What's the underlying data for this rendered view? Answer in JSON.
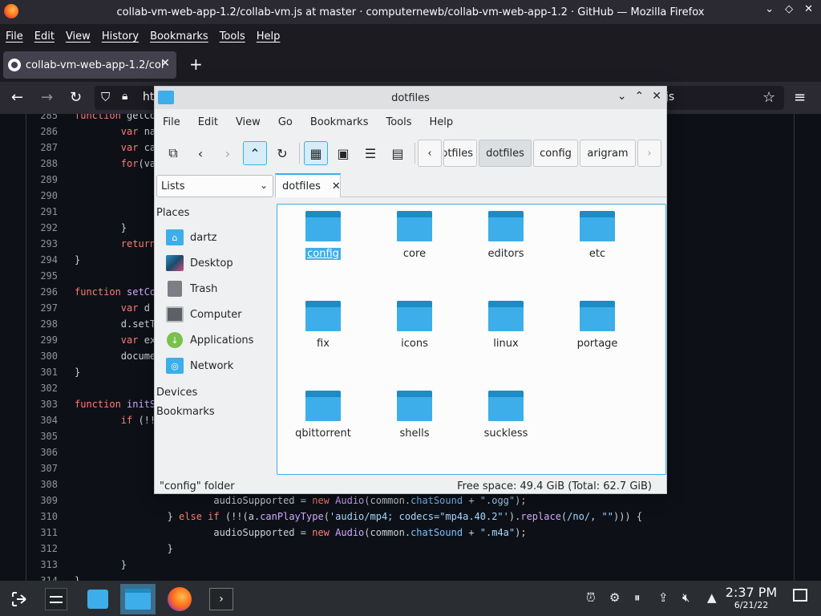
{
  "browser": {
    "window_title": "collab-vm-web-app-1.2/collab-vm.js at master · computernewb/collab-vm-web-app-1.2 · GitHub — Mozilla Firefox",
    "menu": [
      "File",
      "Edit",
      "View",
      "History",
      "Bookmarks",
      "Tools",
      "Help"
    ],
    "tab_title": "collab-vm-web-app-1.2/col",
    "url_fragment": "ht",
    "url_tail": "js"
  },
  "code_lines": [
    {
      "n": "285",
      "html": "<span class='kw'>function</span> getCo"
    },
    {
      "n": "286",
      "html": "        <span class='kw'>var</span> na"
    },
    {
      "n": "287",
      "html": "        <span class='kw'>var</span> ca"
    },
    {
      "n": "288",
      "html": "        <span class='kw'>for</span>(va"
    },
    {
      "n": "289",
      "html": ""
    },
    {
      "n": "290",
      "html": ""
    },
    {
      "n": "291",
      "html": ""
    },
    {
      "n": "292",
      "html": "        }"
    },
    {
      "n": "293",
      "html": "        <span class='kw'>return</span>"
    },
    {
      "n": "294",
      "html": "}"
    },
    {
      "n": "295",
      "html": ""
    },
    {
      "n": "296",
      "html": "<span class='kw'>function</span> <span class='fn'>setCo</span>"
    },
    {
      "n": "297",
      "html": "        <span class='kw'>var</span> d"
    },
    {
      "n": "298",
      "html": "        d.setT"
    },
    {
      "n": "299",
      "html": "        <span class='kw'>var</span> ex"
    },
    {
      "n": "300",
      "html": "        docume"
    },
    {
      "n": "301",
      "html": "}"
    },
    {
      "n": "302",
      "html": ""
    },
    {
      "n": "303",
      "html": "<span class='kw'>function</span> <span class='fn'>initS</span>"
    },
    {
      "n": "304",
      "html": "        <span class='kw'>if</span> (!!"
    },
    {
      "n": "305",
      "html": ""
    },
    {
      "n": "306",
      "html": ""
    },
    {
      "n": "307",
      "html": ""
    },
    {
      "n": "308",
      "html": ""
    },
    {
      "n": "309",
      "html": "                        audioSupported = <span class='kw'>new</span> <span class='fn'>Audio</span>(common.<span class='prop'>chatSound</span> + <span class='str'>\".ogg\"</span>);"
    },
    {
      "n": "310",
      "html": "                } <span class='kw'>else if</span> (!!(a.<span class='fn'>canPlayType</span>(<span class='str'>'audio/mp4; codecs=\"mp4a.40.2\"'</span>).<span class='fn'>replace</span>(<span class='str'>/no/</span>, <span class='str'>\"\"</span>))) {"
    },
    {
      "n": "311",
      "html": "                        audioSupported = <span class='kw'>new</span> <span class='fn'>Audio</span>(common.<span class='prop'>chatSound</span> + <span class='str'>\".m4a\"</span>);"
    },
    {
      "n": "312",
      "html": "                }"
    },
    {
      "n": "313",
      "html": "        }"
    },
    {
      "n": "314",
      "html": "}"
    }
  ],
  "dolphin": {
    "title": "dotfiles",
    "menu": [
      "File",
      "Edit",
      "View",
      "Go",
      "Bookmarks",
      "Tools",
      "Help"
    ],
    "breadcrumbs": [
      "otfiles",
      "dotfiles",
      "config",
      "arigram"
    ],
    "panel_select": "Lists",
    "places_header": "Places",
    "places": [
      {
        "label": "dartz",
        "icon": "home-folder-icon"
      },
      {
        "label": "Desktop",
        "icon": "desktop-icon"
      },
      {
        "label": "Trash",
        "icon": "trash-icon"
      },
      {
        "label": "Computer",
        "icon": "computer-icon"
      },
      {
        "label": "Applications",
        "icon": "applications-icon"
      },
      {
        "label": "Network",
        "icon": "network-icon"
      }
    ],
    "devices_header": "Devices",
    "bookmarks_header": "Bookmarks",
    "tab_label": "dotfiles",
    "folders": [
      "config",
      "core",
      "editors",
      "etc",
      "fix",
      "icons",
      "linux",
      "portage",
      "qbittorrent",
      "shells",
      "suckless"
    ],
    "selected_folder": "config",
    "status_left": "\"config\" folder",
    "status_right": "Free space: 49.4 GiB (Total: 62.7 GiB)"
  },
  "taskbar": {
    "time": "2:37 PM",
    "date": "6/21/22"
  },
  "colors": {
    "accent": "#3daee9",
    "folder": "#3daee9"
  }
}
